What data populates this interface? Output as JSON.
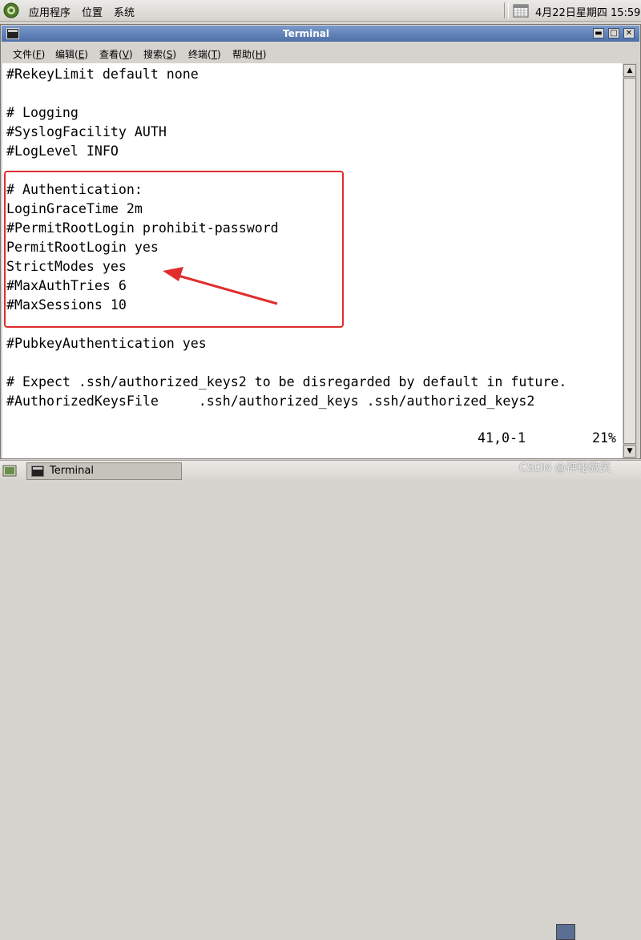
{
  "top_panel": {
    "menus": [
      "应用程序",
      "位置",
      "系统"
    ],
    "clock": "4月22日星期四 15:59"
  },
  "window": {
    "title": "Terminal",
    "menus": [
      {
        "label": "文件(",
        "key": "F",
        "suffix": ")"
      },
      {
        "label": "编辑(",
        "key": "E",
        "suffix": ")"
      },
      {
        "label": "查看(",
        "key": "V",
        "suffix": ")"
      },
      {
        "label": "搜索(",
        "key": "S",
        "suffix": ")"
      },
      {
        "label": "终端(",
        "key": "T",
        "suffix": ")"
      },
      {
        "label": "帮助(",
        "key": "H",
        "suffix": ")"
      }
    ],
    "controls": {
      "minimize": "▬",
      "maximize": "□",
      "close": "✕"
    }
  },
  "terminal": {
    "lines": [
      "#RekeyLimit default none",
      "",
      "# Logging",
      "#SyslogFacility AUTH",
      "#LogLevel INFO",
      "",
      "# Authentication:",
      "LoginGraceTime 2m",
      "#PermitRootLogin prohibit-password",
      "PermitRootLogin yes",
      "StrictModes yes",
      "#MaxAuthTries 6",
      "#MaxSessions 10",
      "",
      "#PubkeyAuthentication yes",
      "",
      "# Expect .ssh/authorized_keys2 to be disregarded by default in future.",
      "#AuthorizedKeysFile     .ssh/authorized_keys .ssh/authorized_keys2"
    ],
    "status_position": "41,0-1",
    "status_percent": "21%"
  },
  "annotation": {
    "box_color": "#e02d2d",
    "arrow_color": "#e02d2d"
  },
  "taskbar": {
    "task_label": "Terminal"
  },
  "watermark": "CSDN @神秘微笑",
  "icons": {
    "menu_logo": "gnome-foot-icon",
    "calendar": "calendar-icon",
    "terminal": "terminal-icon",
    "show_desktop": "show-desktop-icon"
  }
}
